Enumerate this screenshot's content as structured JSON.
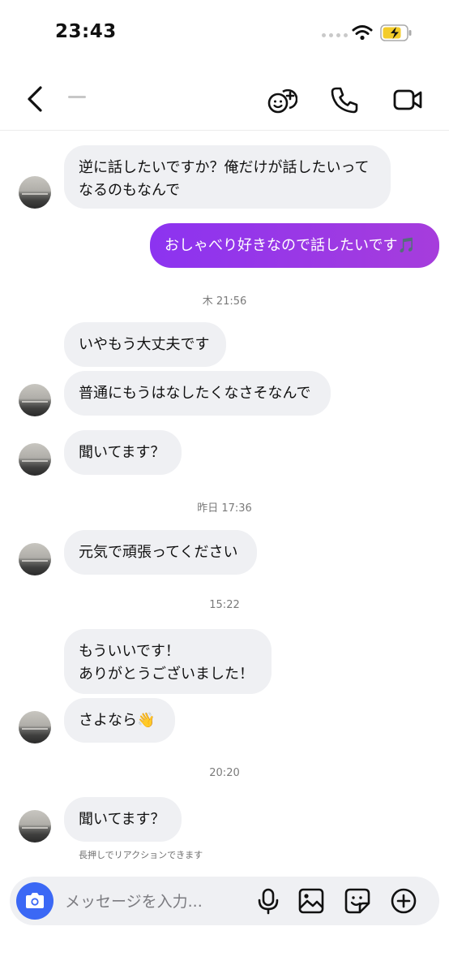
{
  "status_bar": {
    "time": "23:43"
  },
  "messages": [
    {
      "id": "m1",
      "text": "逆に話したいですか？俺だけが話したいって\nなるのもなんで"
    },
    {
      "id": "m2",
      "text": "おしゃべり好きなので話したいです🎵"
    },
    {
      "id": "ts1",
      "text": "木 21:56"
    },
    {
      "id": "m3",
      "text": "いやもう大丈夫です"
    },
    {
      "id": "m4",
      "text": "普通にもうはなしたくなさそなんで"
    },
    {
      "id": "m5",
      "text": "聞いてます？"
    },
    {
      "id": "ts2",
      "text": "昨日 17:36"
    },
    {
      "id": "m6",
      "text": "元気で頑張ってください"
    },
    {
      "id": "ts3",
      "text": "15:22"
    },
    {
      "id": "m7",
      "text": "もういいです！\nありがとうございました！"
    },
    {
      "id": "m8",
      "text": "さよなら👋"
    },
    {
      "id": "ts4",
      "text": "20:20"
    },
    {
      "id": "m9",
      "text": "聞いてます？"
    }
  ],
  "hint": "長押しでリアクションできます",
  "composer": {
    "placeholder": "メッセージを入力..."
  },
  "colors": {
    "outgoing_bubble": "#9b37e8",
    "incoming_bubble": "#eff0f3",
    "camera_button": "#3b68f5"
  },
  "icons": [
    "back-icon",
    "add-people-icon",
    "phone-icon",
    "video-icon",
    "camera-icon",
    "mic-icon",
    "image-icon",
    "sticker-icon",
    "plus-icon"
  ]
}
